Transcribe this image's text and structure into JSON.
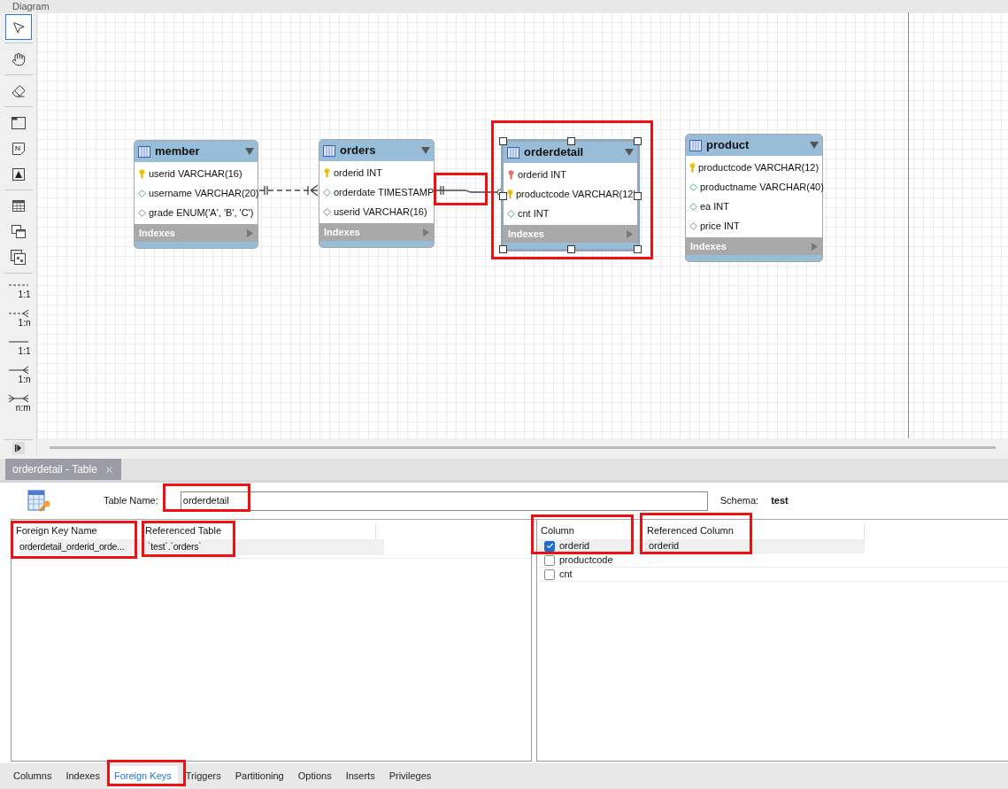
{
  "diagram": {
    "title": "Diagram",
    "tools": [
      {
        "kind": "pointer",
        "selected": true
      },
      {
        "kind": "hand",
        "selected": false
      },
      {
        "kind": "eraser",
        "selected": false
      },
      {
        "kind": "layer",
        "selected": false
      },
      {
        "kind": "note",
        "selected": false
      },
      {
        "kind": "image",
        "selected": false
      },
      {
        "kind": "table",
        "selected": false
      },
      {
        "kind": "view",
        "selected": false
      },
      {
        "kind": "routine",
        "selected": false
      },
      {
        "kind": "rel-dashed",
        "label": "1:1",
        "selected": false
      },
      {
        "kind": "rel-dashed-many",
        "label": "1:n",
        "selected": false
      },
      {
        "kind": "rel-solid",
        "label": "1:1",
        "selected": false
      },
      {
        "kind": "rel-solid-many",
        "label": "1:n",
        "selected": false
      },
      {
        "kind": "rel-many-many",
        "label": "n:m",
        "selected": false
      }
    ],
    "entities": [
      {
        "name": "member",
        "selected": false,
        "columns": [
          {
            "kind": "pk",
            "text": "userid VARCHAR(16)"
          },
          {
            "kind": "column",
            "text": "username VARCHAR(20)"
          },
          {
            "kind": "column",
            "text": "grade ENUM('A', 'B', 'C')"
          }
        ],
        "footer": "Indexes"
      },
      {
        "name": "orders",
        "selected": false,
        "columns": [
          {
            "kind": "pk",
            "text": "orderid INT"
          },
          {
            "kind": "column",
            "text": "orderdate TIMESTAMP"
          },
          {
            "kind": "fk",
            "text": "userid VARCHAR(16)"
          }
        ],
        "footer": "Indexes"
      },
      {
        "name": "orderdetail",
        "selected": true,
        "columns": [
          {
            "kind": "pk_fk",
            "text": "orderid INT"
          },
          {
            "kind": "pk",
            "text": "productcode VARCHAR(12)"
          },
          {
            "kind": "column",
            "text": "cnt INT"
          }
        ],
        "footer": "Indexes"
      },
      {
        "name": "product",
        "selected": false,
        "columns": [
          {
            "kind": "pk",
            "text": "productcode VARCHAR(12)"
          },
          {
            "kind": "column",
            "text": "productname VARCHAR(40)"
          },
          {
            "kind": "column",
            "text": "ea INT"
          },
          {
            "kind": "column",
            "text": "price INT"
          }
        ],
        "footer": "Indexes"
      }
    ],
    "relationships": [
      {
        "identifying": false
      },
      {
        "identifying": true
      }
    ]
  },
  "editor_tab": {
    "label": "orderdetail - Table"
  },
  "table_name": {
    "label": "Table Name:",
    "value": "orderdetail"
  },
  "schema": {
    "label": "Schema:",
    "value": "test"
  },
  "foreign_keys": {
    "columns": [
      "Foreign Key Name",
      "Referenced Table"
    ],
    "rows": [
      {
        "selected": true,
        "cells": [
          "orderdetail_orderid_orde...",
          "`test`.`orders`"
        ]
      }
    ]
  },
  "fk_columns": {
    "columns": [
      "Column",
      "Referenced Column"
    ],
    "rows": [
      {
        "checked": true,
        "name": "orderid",
        "referenced": "orderid"
      },
      {
        "checked": false,
        "name": "productcode"
      },
      {
        "checked": false,
        "name": "cnt"
      }
    ]
  },
  "bottom_tabs": [
    {
      "label": "Columns",
      "selected": false
    },
    {
      "label": "Indexes",
      "selected": false
    },
    {
      "label": "Foreign Keys",
      "selected": true
    },
    {
      "label": "Triggers",
      "selected": false
    },
    {
      "label": "Partitioning",
      "selected": false
    },
    {
      "label": "Options",
      "selected": false
    },
    {
      "label": "Inserts",
      "selected": false
    },
    {
      "label": "Privileges",
      "selected": false
    }
  ]
}
